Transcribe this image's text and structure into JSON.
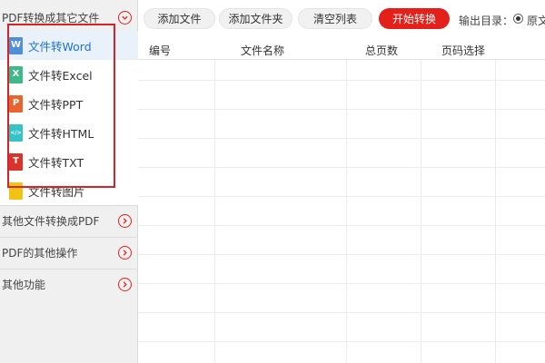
{
  "sidebar": {
    "sections": [
      {
        "label": "PDF转换成其它文件",
        "expanded": true
      },
      {
        "label": "其他文件转换成PDF",
        "expanded": false
      },
      {
        "label": "PDF的其他操作",
        "expanded": false
      },
      {
        "label": "其他功能",
        "expanded": false
      }
    ],
    "items": [
      {
        "label": "文件转Word",
        "icon": "word-file-icon",
        "glyph": "W"
      },
      {
        "label": "文件转Excel",
        "icon": "excel-file-icon",
        "glyph": "X"
      },
      {
        "label": "文件转PPT",
        "icon": "ppt-file-icon",
        "glyph": "P"
      },
      {
        "label": "文件转HTML",
        "icon": "html-file-icon",
        "glyph": "</>"
      },
      {
        "label": "文件转TXT",
        "icon": "txt-file-icon",
        "glyph": "T"
      },
      {
        "label": "文件转图片",
        "icon": "image-file-icon",
        "glyph": ""
      }
    ],
    "active_item": 0
  },
  "toolbar": {
    "add_file": "添加文件",
    "add_folder": "添加文件夹",
    "clear_list": "清空列表",
    "start_convert": "开始转换",
    "output_label": "输出目录：",
    "output_option": "原文"
  },
  "table": {
    "columns": [
      "编号",
      "文件名称",
      "总页数",
      "页码选择"
    ]
  },
  "colors": {
    "accent_red": "#e3211a",
    "active_blue": "#1a73d9",
    "highlight_box": "#d8222a"
  }
}
